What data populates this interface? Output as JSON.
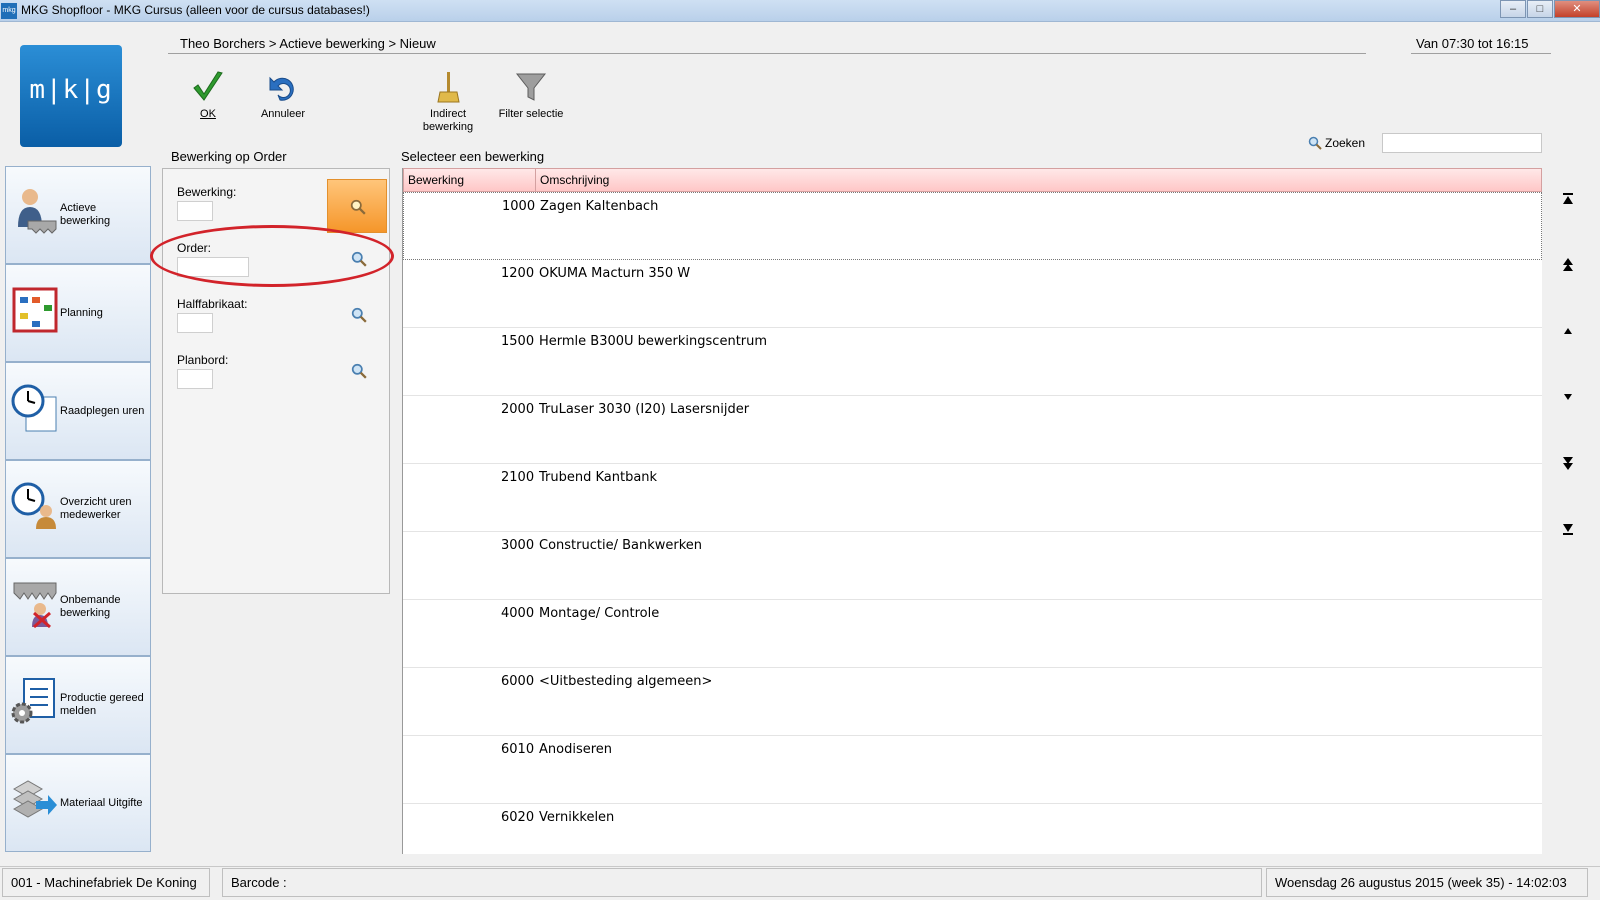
{
  "window": {
    "title": "MKG Shopfloor - MKG Cursus (alleen voor de cursus databases!)",
    "app_icon": "mkg",
    "controls": [
      "minimize-icon",
      "maximize-icon",
      "close-icon"
    ]
  },
  "logo": {
    "text": "m|k|g"
  },
  "header": {
    "breadcrumb": "Theo Borchers > Actieve bewerking > Nieuw",
    "time_range": "Van 07:30 tot 16:15"
  },
  "toolbar": {
    "ok_label": "OK",
    "annuleer_label": "Annuleer",
    "indirect_label_1": "Indirect",
    "indirect_label_2": "bewerking",
    "filter_label": "Filter selectie"
  },
  "search": {
    "label": "Zoeken",
    "value": ""
  },
  "sidebar": {
    "items": [
      {
        "label": "Actieve bewerking",
        "icon": "worker-saw-icon"
      },
      {
        "label": "Planning",
        "icon": "calendar-icon"
      },
      {
        "label": "Raadplegen uren",
        "icon": "clock-document-icon"
      },
      {
        "label": "Overzicht uren medewerker",
        "icon": "clock-person-icon"
      },
      {
        "label": "Onbemande bewerking",
        "icon": "saw-cross-icon"
      },
      {
        "label": "Productie gereed melden",
        "icon": "document-gear-icon"
      },
      {
        "label": "Materiaal Uitgifte",
        "icon": "stack-arrow-icon"
      }
    ]
  },
  "form": {
    "title": "Bewerking op Order",
    "bewerking_label": "Bewerking:",
    "order_label": "Order:",
    "halffabrikaat_label": "Halffabrikaat:",
    "planbord_label": "Planbord:"
  },
  "list": {
    "title": "Selecteer een bewerking",
    "columns": [
      "Bewerking",
      "Omschrijving"
    ],
    "rows": [
      {
        "code": "1000",
        "desc": "Zagen Kaltenbach"
      },
      {
        "code": "1200",
        "desc": "OKUMA Macturn 350 W"
      },
      {
        "code": "1500",
        "desc": "Hermle B300U bewerkingscentrum"
      },
      {
        "code": "2000",
        "desc": "TruLaser 3030 (I20) Lasersnijder"
      },
      {
        "code": "2100",
        "desc": "Trubend Kantbank"
      },
      {
        "code": "3000",
        "desc": "Constructie/ Bankwerken"
      },
      {
        "code": "4000",
        "desc": "Montage/ Controle"
      },
      {
        "code": "6000",
        "desc": "<Uitbesteding algemeen>"
      },
      {
        "code": "6010",
        "desc": "Anodiseren"
      },
      {
        "code": "6020",
        "desc": "Vernikkelen"
      }
    ]
  },
  "status": {
    "company": "001 - Machinefabriek De Koning",
    "barcode_label": "Barcode :",
    "datetime": "Woensdag 26 augustus 2015 (week 35)  -  14:02:03"
  },
  "colors": {
    "annotation": "#d2232a",
    "header_pink": "#ffc7c7",
    "lookup_orange": "#f5962a",
    "ok_green": "#2e9a2e",
    "annuleer_blue": "#2a6fc0"
  }
}
